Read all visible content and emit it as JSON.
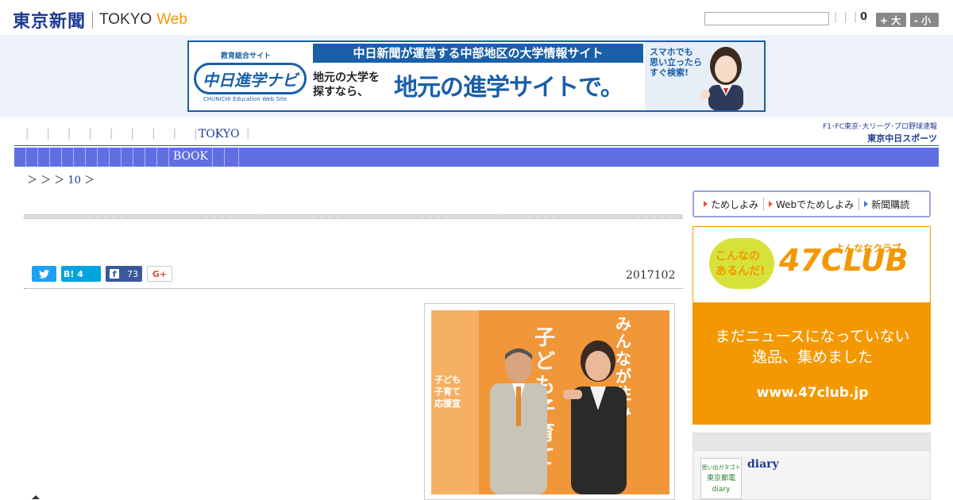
{
  "header": {
    "logo_jp": "東京新聞",
    "logo_en": "TOKYO",
    "logo_web": "Web",
    "pipes": "| | | |",
    "count": "0",
    "font_big": "+ 大",
    "font_small": "- 小"
  },
  "banner": {
    "logo_sub": "教育総合サイト",
    "logo_main": "中日進学ナビ",
    "logo_en": "CHUNICHI Education Web Site",
    "headline": "中日新聞が運営する中部地区の大学情報サイト",
    "left_text_1": "地元の大学を",
    "left_text_2": "探すなら、",
    "main_text": "地元の進学サイトで。",
    "vertical_text_1": "スマホでも",
    "vertical_text_2": "思い立ったら",
    "vertical_text_3": "すぐ検索!"
  },
  "nav": {
    "ticks": "| | | | | | | | | |",
    "tokyo": "TOKYO",
    "tick_end": "|",
    "book": "BOOK",
    "chunichi_small": "F1･FC東京･大リーグ･プロ野球速報",
    "chunichi_big": "東京中日スポーツ"
  },
  "breadcrumb": {
    "prefix": "＞ ＞ ＞",
    "link": "10",
    "suffix": "＞"
  },
  "article": {
    "date": "2017102",
    "share_hatena": "B! 4",
    "share_facebook": "73",
    "share_gplus": "G+",
    "photo_left_text": "子ども\n子育て\n応援宣",
    "photo_vertical_1": "みんなが住み",
    "photo_vertical_2": "子ども子育て"
  },
  "sidebar": {
    "try_1": "ためしよみ",
    "try_2": "Webでためしよみ",
    "try_3": "新聞購読",
    "ad47_bubble": "こんなの\nあるんだ!",
    "ad47_club": "47CLUB",
    "ad47_kana": "よんななクラブ",
    "ad47_msg_1": "まだニュースになっていない",
    "ad47_msg_2": "逸品、集めました",
    "ad47_url": "www.47club.jp",
    "diary_thumb_1": "思い出ガタゴト",
    "diary_thumb_2": "東京都電",
    "diary_thumb_3": "diary",
    "diary_title": "diary"
  },
  "colors": {
    "brand": "#1f3a93",
    "nav_blue": "#5f6fe0",
    "orange": "#f39800",
    "twitter": "#1da1f2",
    "facebook": "#3b5998"
  }
}
